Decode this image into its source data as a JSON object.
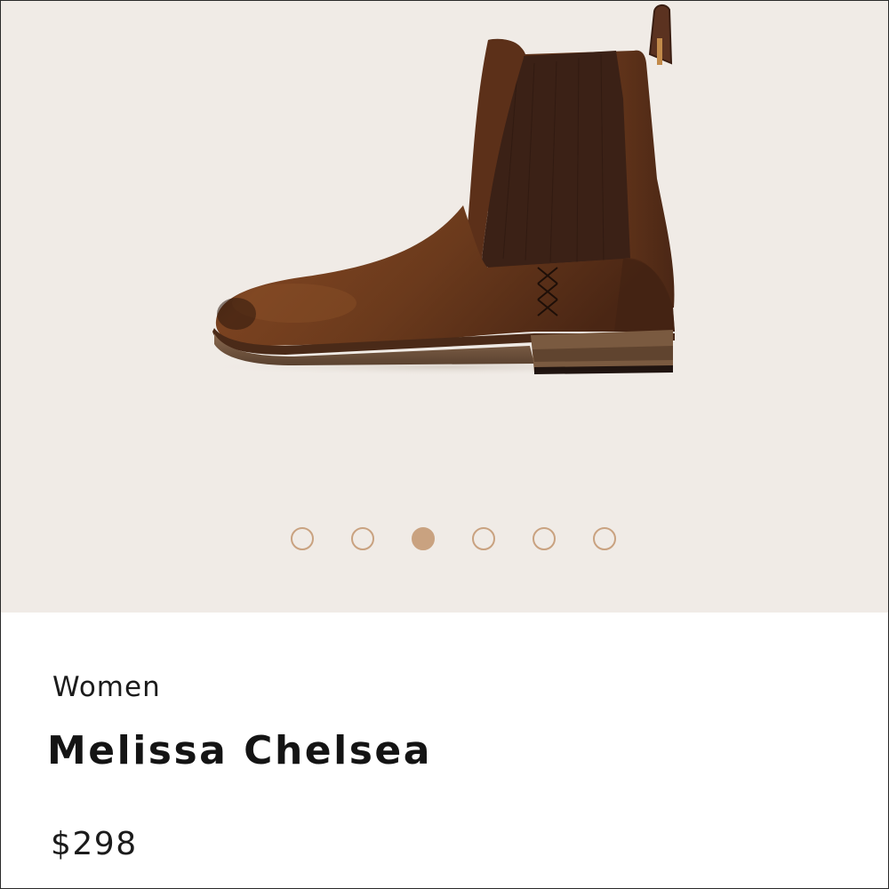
{
  "product": {
    "category": "Women",
    "name": "Melissa Chelsea",
    "price": "$298",
    "image_subject": "brown leather chelsea boot"
  },
  "gallery": {
    "total_images": 6,
    "active_index": 2,
    "dots": [
      {
        "state": "inactive"
      },
      {
        "state": "inactive"
      },
      {
        "state": "active"
      },
      {
        "state": "inactive"
      },
      {
        "state": "inactive"
      },
      {
        "state": "inactive"
      }
    ]
  },
  "colors": {
    "gallery_background": "#f0ebe6",
    "dot_accent": "#c9a280",
    "text": "#1b1b1b"
  }
}
